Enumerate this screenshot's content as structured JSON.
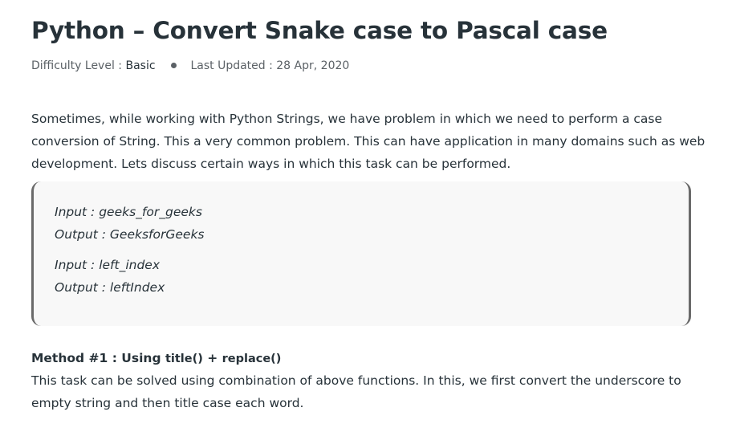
{
  "article": {
    "title": "Python – Convert Snake case to Pascal case",
    "meta": {
      "difficulty_label": "Difficulty Level : ",
      "difficulty_value": "Basic",
      "updated_label": "Last Updated : 28 Apr, 2020"
    },
    "intro_lines": [
      "Sometimes, while working with Python Strings, we have problem in which we need to perform a case",
      "conversion of String. This a very common problem. This can have application in many domains such as web",
      "development. Lets discuss certain ways in which this task can be performed."
    ],
    "examples": [
      {
        "input": "Input : geeks_for_geeks",
        "output": "Output : GeeksforGeeks"
      },
      {
        "input": "Input : left_index",
        "output": "Output : leftIndex"
      }
    ],
    "method": {
      "prefix": "Method #1 : Using ",
      "fn1": "title()",
      "joiner": " + ",
      "fn2": "replace()"
    },
    "method_desc_lines": [
      "This task can be solved using combination of above functions. In this, we first convert the underscore to",
      "empty string and then title case each word."
    ]
  }
}
